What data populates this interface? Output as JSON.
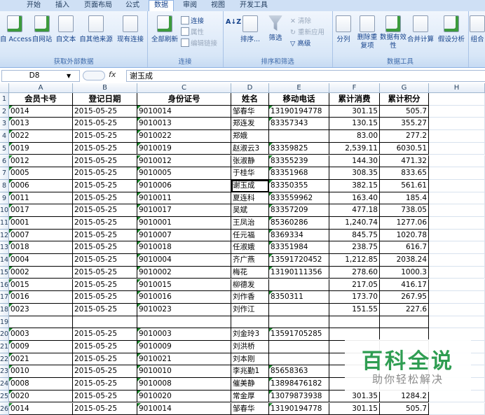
{
  "ribbon_tabs": [
    "开始",
    "插入",
    "页面布局",
    "公式",
    "数据",
    "审阅",
    "视图",
    "开发工具"
  ],
  "active_tab": "数据",
  "groups": {
    "external": {
      "title": "获取外部数据",
      "buttons": [
        "自 Access",
        "自网站",
        "自文本",
        "自其他来源",
        "现有连接"
      ]
    },
    "connections": {
      "title": "连接",
      "refresh": "全部刷新",
      "connections": "连接",
      "properties": "属性",
      "edit_links": "编辑链接"
    },
    "sort_filter": {
      "title": "排序和筛选",
      "sort_asc": "A↓Z",
      "sort": "排序...",
      "filter": "筛选",
      "clear": "清除",
      "reapply": "重新应用",
      "advanced": "高级"
    },
    "tools": {
      "title": "数据工具",
      "split": "分列",
      "remove_dup": "删除重复项",
      "validation": "数据有效性",
      "consolidate": "合并计算",
      "whatif": "假设分析"
    },
    "outline": {
      "combine": "组合"
    }
  },
  "formula_bar": {
    "name_box": "D8",
    "fx": "fx",
    "content": "谢玉成"
  },
  "columns": [
    "A",
    "B",
    "C",
    "D",
    "E",
    "F",
    "G",
    "H"
  ],
  "headers": [
    "会员卡号",
    "登记日期",
    "身份证号",
    "姓名",
    "移动电话",
    "累计消费",
    "累计积分"
  ],
  "rows": [
    [
      "1",
      [
        "会员卡号",
        "登记日期",
        "身份证号",
        "姓名",
        "移动电话",
        "累计消费",
        "累计积分"
      ]
    ],
    [
      "2",
      [
        "0014",
        "2015-05-25",
        "9010014",
        "邹春华",
        "13190194778",
        "301.15",
        "505.7"
      ]
    ],
    [
      "3",
      [
        "0013",
        "2015-05-25",
        "9010013",
        "郑连发",
        "83357343",
        "130.15",
        "355.27"
      ]
    ],
    [
      "4",
      [
        "0022",
        "2015-05-25",
        "9010022",
        "郑娥",
        "",
        "83.00",
        "277.2"
      ]
    ],
    [
      "5",
      [
        "0019",
        "2015-05-25",
        "9010019",
        "赵淑云3",
        "83359825",
        "2,539.11",
        "6030.51"
      ]
    ],
    [
      "6",
      [
        "0012",
        "2015-05-25",
        "9010012",
        "张淑静",
        "83355239",
        "144.30",
        "471.32"
      ]
    ],
    [
      "7",
      [
        "0005",
        "2015-05-25",
        "9010005",
        "于桂华",
        "83351968",
        "308.35",
        "833.65"
      ]
    ],
    [
      "8",
      [
        "0006",
        "2015-05-25",
        "9010006",
        "谢玉成",
        "83350355",
        "382.15",
        "561.61"
      ]
    ],
    [
      "9",
      [
        "0011",
        "2015-05-25",
        "9010011",
        "夏连科",
        "833559962",
        "163.40",
        "185.4"
      ]
    ],
    [
      "10",
      [
        "0017",
        "2015-05-25",
        "9010017",
        "吴斌",
        "83357209",
        "477.18",
        "738.05"
      ]
    ],
    [
      "11",
      [
        "0001",
        "2015-05-25",
        "9010001",
        "王凤治",
        "85360286",
        "1,240.74",
        "1277.06"
      ]
    ],
    [
      "12",
      [
        "0007",
        "2015-05-25",
        "9010007",
        "任元福",
        "8369334",
        "845.75",
        "1020.78"
      ]
    ],
    [
      "13",
      [
        "0018",
        "2015-05-25",
        "9010018",
        "任淑娥",
        "83351984",
        "238.75",
        "616.7"
      ]
    ],
    [
      "14",
      [
        "0004",
        "2015-05-25",
        "9010004",
        "齐广燕",
        "13591720452",
        "1,212.85",
        "2038.24"
      ]
    ],
    [
      "15",
      [
        "0002",
        "2015-05-25",
        "9010002",
        "梅花",
        "13190111356",
        "278.60",
        "1000.3"
      ]
    ],
    [
      "16",
      [
        "0015",
        "2015-05-25",
        "9010015",
        "柳德发",
        "",
        "217.05",
        "416.17"
      ]
    ],
    [
      "17",
      [
        "0016",
        "2015-05-25",
        "9010016",
        "刘作香",
        "8350311",
        "173.70",
        "267.95"
      ]
    ],
    [
      "18",
      [
        "0023",
        "2015-05-25",
        "9010023",
        "刘作江",
        "",
        "151.55",
        "227.6"
      ]
    ],
    [
      "19",
      [
        "",
        "",
        "",
        "",
        "",
        "",
        ""
      ]
    ],
    [
      "20",
      [
        "0003",
        "2015-05-25",
        "9010003",
        "刘金玲3",
        "13591705285",
        "",
        ""
      ]
    ],
    [
      "21",
      [
        "0009",
        "2015-05-25",
        "9010009",
        "刘洪桥",
        "",
        "",
        ""
      ]
    ],
    [
      "22",
      [
        "0021",
        "2015-05-25",
        "9010021",
        "刘本刚",
        "",
        "",
        ""
      ]
    ],
    [
      "23",
      [
        "0010",
        "2015-05-25",
        "9010010",
        "李兆勤1",
        "85658363",
        "",
        ""
      ]
    ],
    [
      "24",
      [
        "0008",
        "2015-05-25",
        "9010008",
        "催美静",
        "13898476182",
        "",
        ""
      ]
    ],
    [
      "25",
      [
        "0020",
        "2015-05-25",
        "9010020",
        "常金厚",
        "13079873938",
        "301.35",
        "1284.2"
      ]
    ],
    [
      "26",
      [
        "0014",
        "2015-05-25",
        "9010014",
        "邹春华",
        "13190194778",
        "301.15",
        "505.7"
      ]
    ]
  ],
  "watermark": {
    "title": "百科全说",
    "subtitle": "助你轻松解决"
  }
}
